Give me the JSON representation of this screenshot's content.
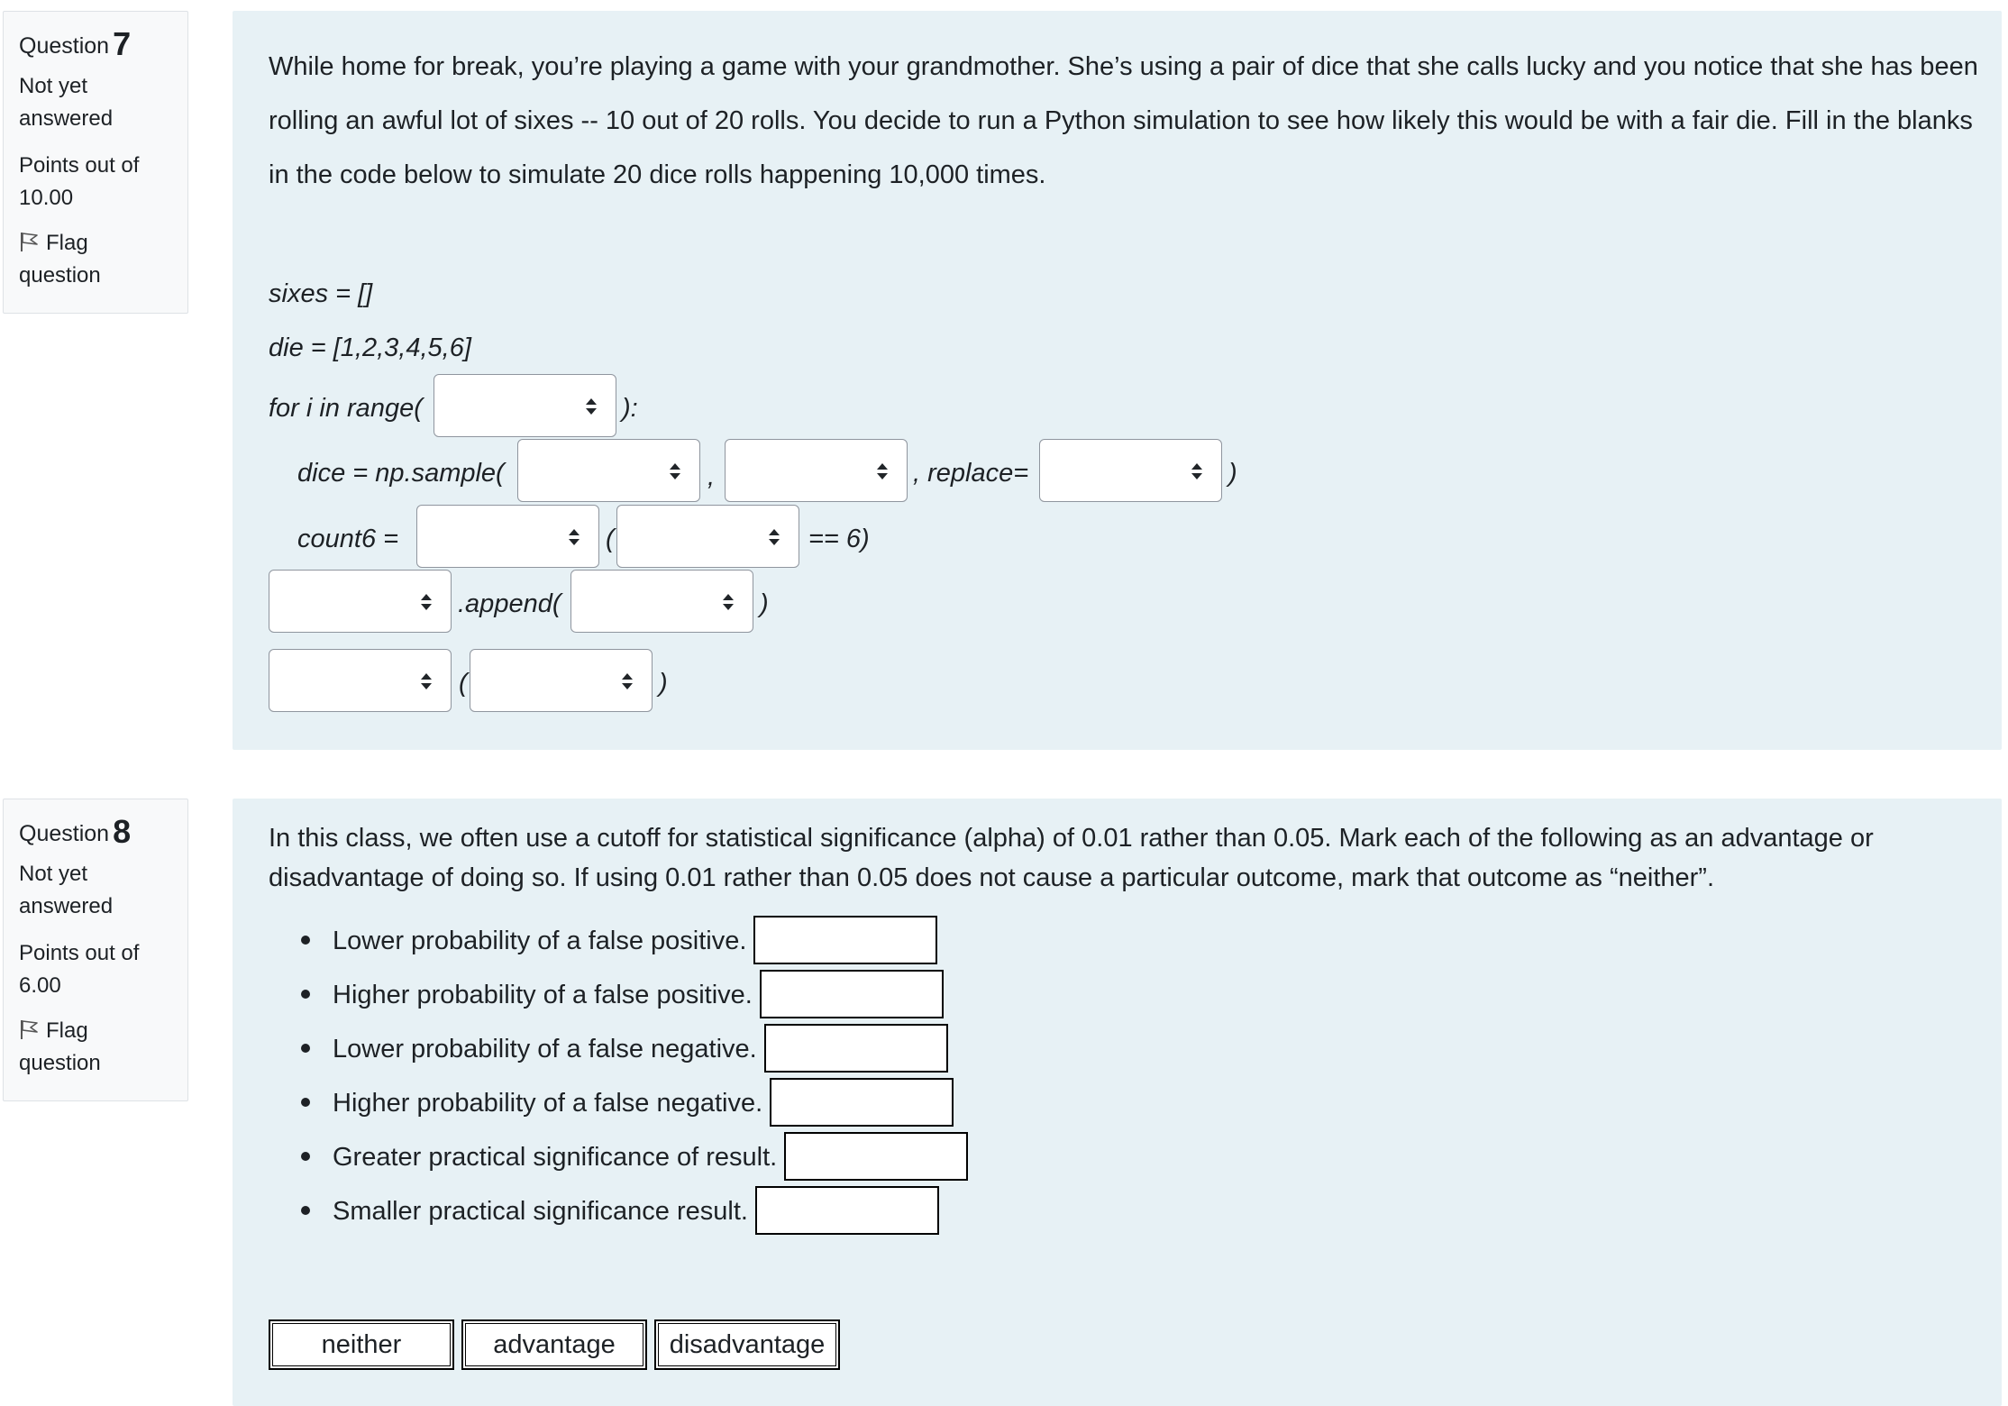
{
  "q7": {
    "label": "Question",
    "number": "7",
    "state": "Not yet answered",
    "grade": "Points out of 10.00",
    "flag": "Flag question",
    "text": "While home for break, you’re playing a game with your grandmother. She’s using a pair of dice that she calls lucky and you notice that she has been rolling an awful lot of sixes -- 10 out of 20 rolls. You decide to run a Python simulation to see how likely this would be with a fair die. Fill in the blanks in the code below to simulate 20 dice rolls happening 10,000 times.",
    "code": {
      "line1": "sixes = []",
      "line2": "die = [1,2,3,4,5,6]",
      "line3_pre": "for i in range(",
      "line3_post": "):",
      "line4_pre": "dice = np.sample(",
      "line4_comma": ",",
      "line4_mid": ", replace=",
      "line4_post": ")",
      "line5_pre": "count6 =",
      "line5_paren": "(",
      "line5_post": "== 6)",
      "line6_mid": ".append(",
      "line6_post": ")",
      "line7_paren": "(",
      "line7_post": ")"
    }
  },
  "q8": {
    "label": "Question",
    "number": "8",
    "state": "Not yet answered",
    "grade": "Points out of 6.00",
    "flag": "Flag question",
    "text": "In this class, we often use a cutoff for statistical significance (alpha) of 0.01 rather than 0.05. Mark each of the following as an advantage or disadvantage of doing so. If using 0.01 rather than 0.05 does not cause a particular outcome, mark that outcome as “neither”.",
    "items": [
      "Lower probability of a false positive.",
      "Higher probability of a false positive.",
      "Lower probability of a false negative.",
      "Higher probability of a false negative.",
      "Greater practical significance of result.",
      "Smaller practical significance result."
    ],
    "choices": [
      "neither",
      "advantage",
      "disadvantage"
    ]
  },
  "icons": {
    "flag": "flag-icon",
    "select_arrow": "up-down-arrow-icon"
  },
  "colors": {
    "content_bg": "#e7f1f5",
    "info_bg": "#f8f9fa",
    "text": "#1d2125",
    "border": "#dee2e6"
  }
}
